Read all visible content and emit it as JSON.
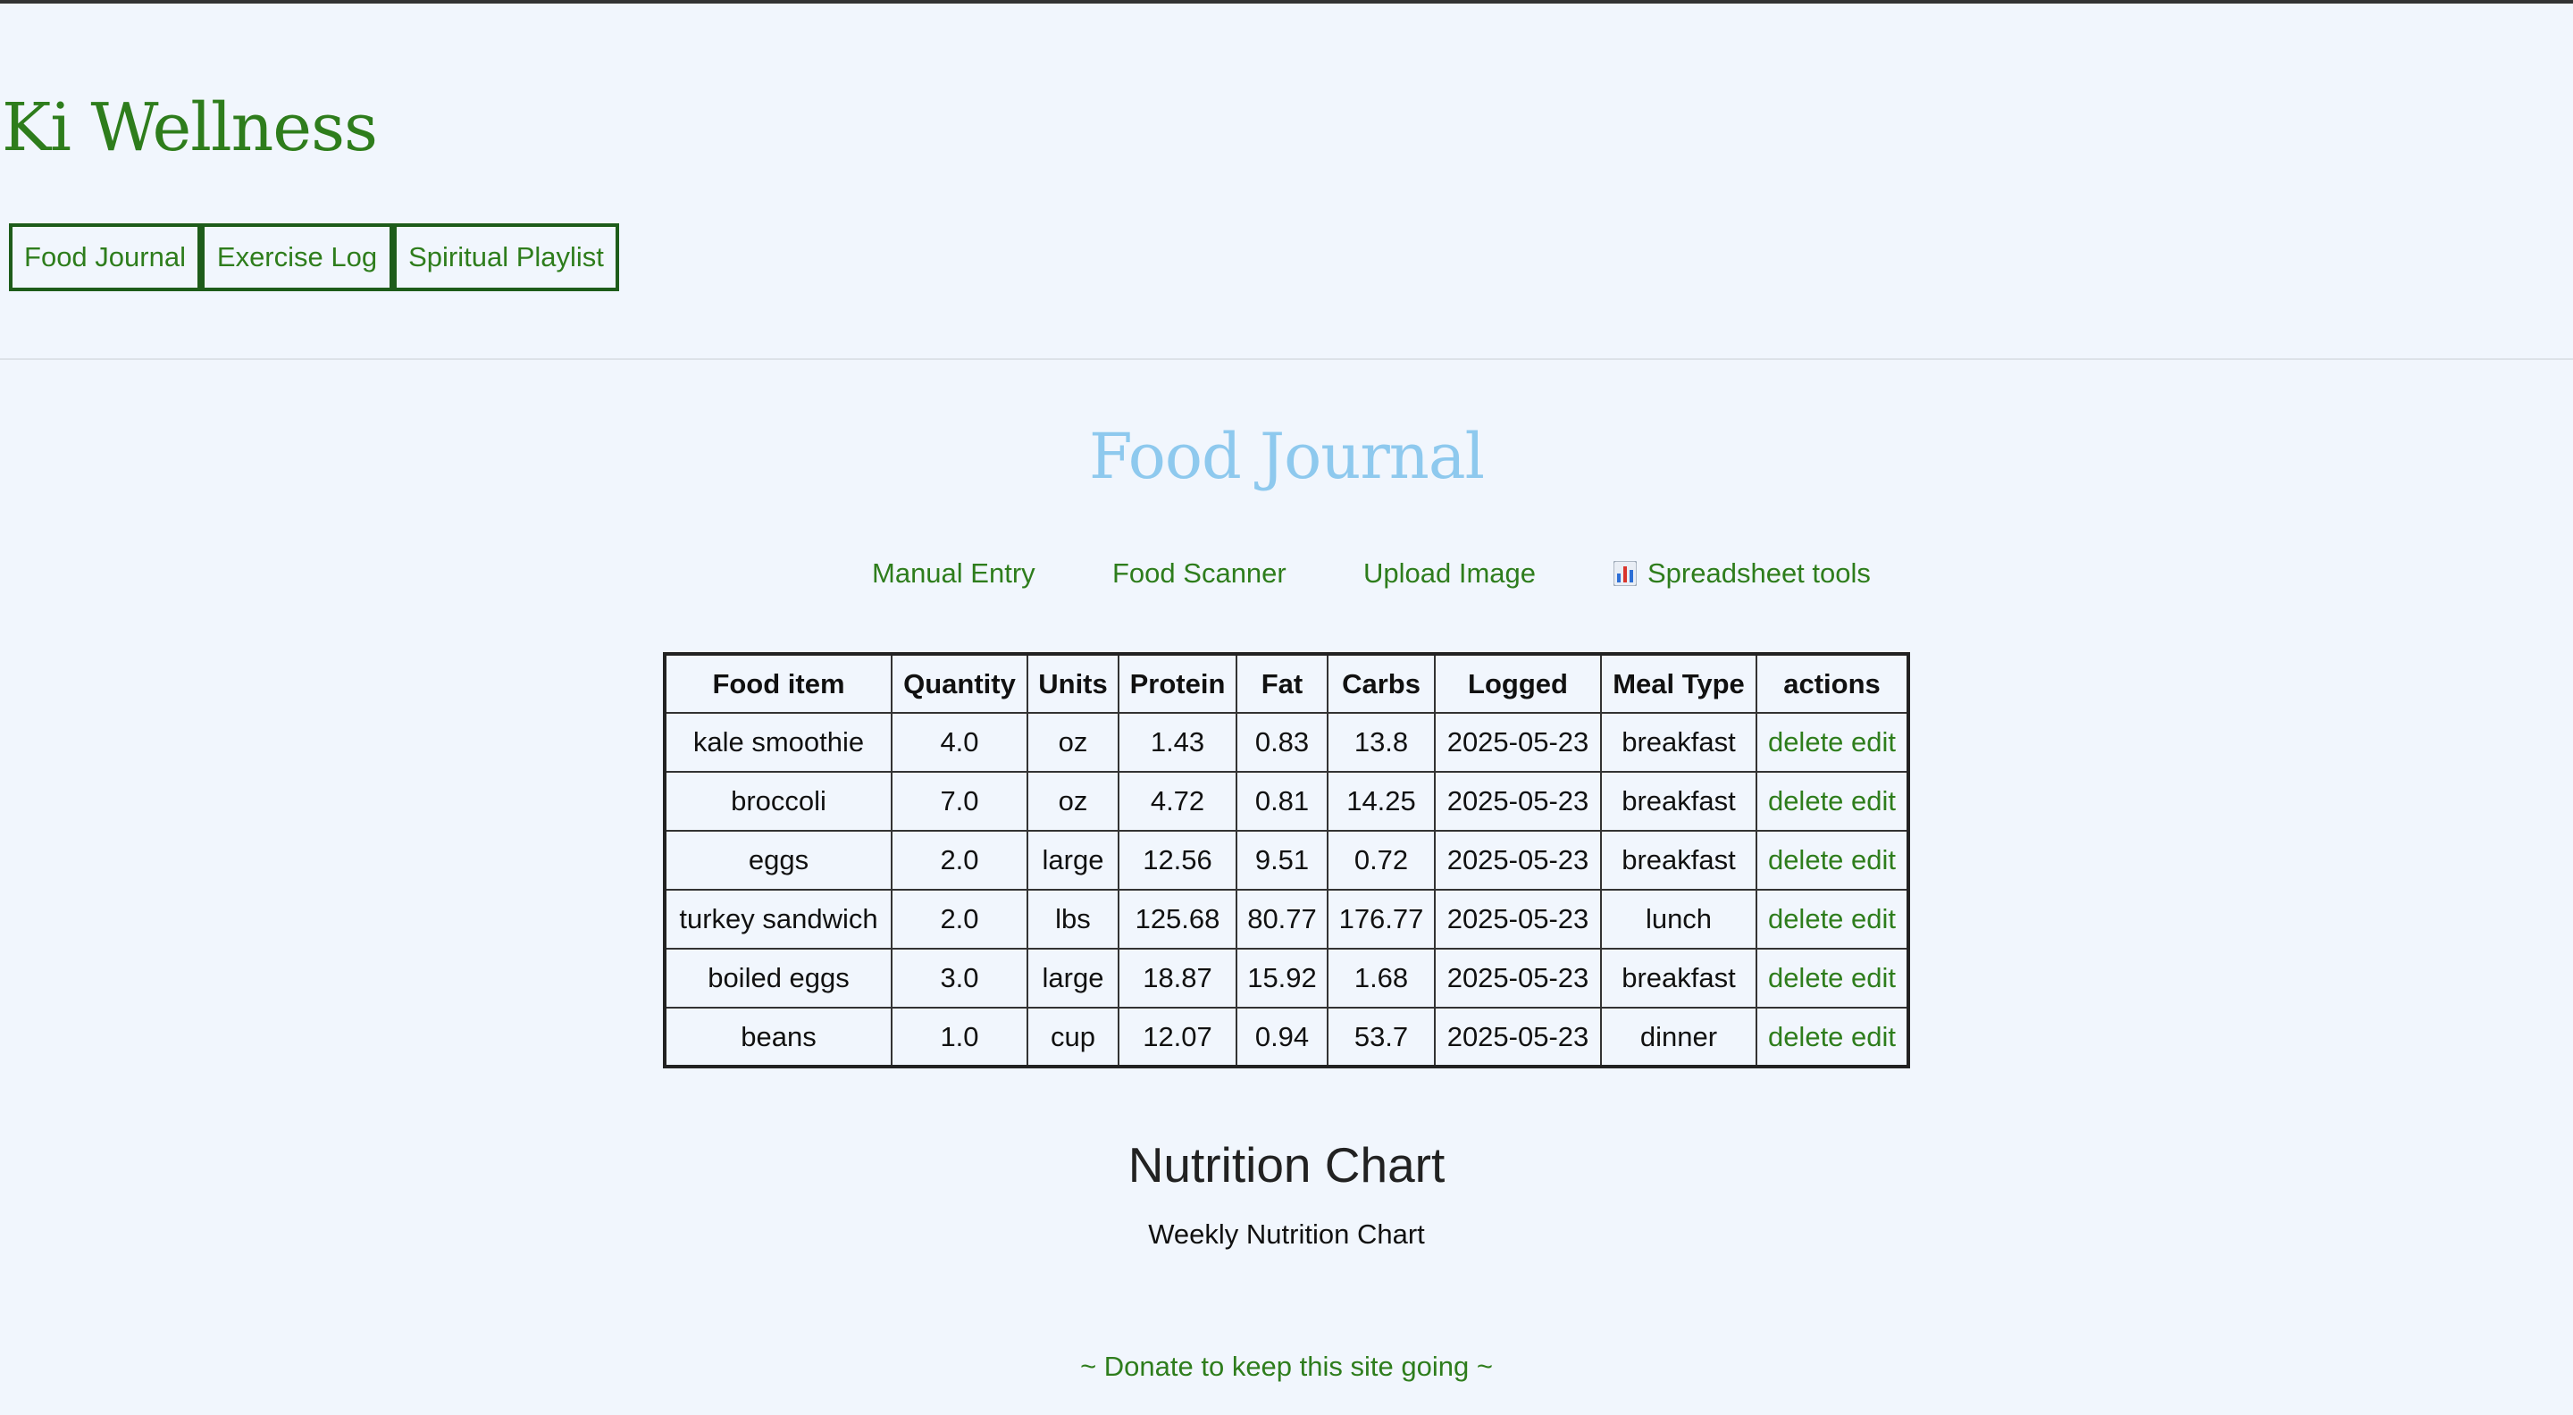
{
  "brand": "Ki Wellness",
  "nav": {
    "food_journal": "Food Journal",
    "exercise_log": "Exercise Log",
    "spiritual_playlist": "Spiritual Playlist"
  },
  "page_title": "Food Journal",
  "tools": {
    "manual_entry": "Manual Entry",
    "food_scanner": "Food Scanner",
    "upload_image": "Upload Image",
    "spreadsheet_tools": "Spreadsheet tools",
    "spreadsheet_icon": "bar-chart-icon"
  },
  "table": {
    "headers": [
      "Food item",
      "Quantity",
      "Units",
      "Protein",
      "Fat",
      "Carbs",
      "Logged",
      "Meal Type",
      "actions"
    ],
    "rows": [
      {
        "food": "kale smoothie",
        "quantity": "4.0",
        "units": "oz",
        "protein": "1.43",
        "fat": "0.83",
        "carbs": "13.8",
        "logged": "2025-05-23",
        "meal": "breakfast"
      },
      {
        "food": "broccoli",
        "quantity": "7.0",
        "units": "oz",
        "protein": "4.72",
        "fat": "0.81",
        "carbs": "14.25",
        "logged": "2025-05-23",
        "meal": "breakfast"
      },
      {
        "food": "eggs",
        "quantity": "2.0",
        "units": "large",
        "protein": "12.56",
        "fat": "9.51",
        "carbs": "0.72",
        "logged": "2025-05-23",
        "meal": "breakfast"
      },
      {
        "food": "turkey sandwich",
        "quantity": "2.0",
        "units": "lbs",
        "protein": "125.68",
        "fat": "80.77",
        "carbs": "176.77",
        "logged": "2025-05-23",
        "meal": "lunch"
      },
      {
        "food": "boiled eggs",
        "quantity": "3.0",
        "units": "large",
        "protein": "18.87",
        "fat": "15.92",
        "carbs": "1.68",
        "logged": "2025-05-23",
        "meal": "breakfast"
      },
      {
        "food": "beans",
        "quantity": "1.0",
        "units": "cup",
        "protein": "12.07",
        "fat": "0.94",
        "carbs": "53.7",
        "logged": "2025-05-23",
        "meal": "dinner"
      }
    ],
    "delete_label": "delete",
    "edit_label": "edit"
  },
  "nutrition": {
    "heading": "Nutrition Chart",
    "subheading": "Weekly Nutrition Chart"
  },
  "donate": "~ Donate to keep this site going ~",
  "colors": {
    "background": "#f1f6fd",
    "accent_green": "#2e7d1c",
    "title_blue": "#8ec9ee",
    "nav_border": "#1e5c1a"
  }
}
